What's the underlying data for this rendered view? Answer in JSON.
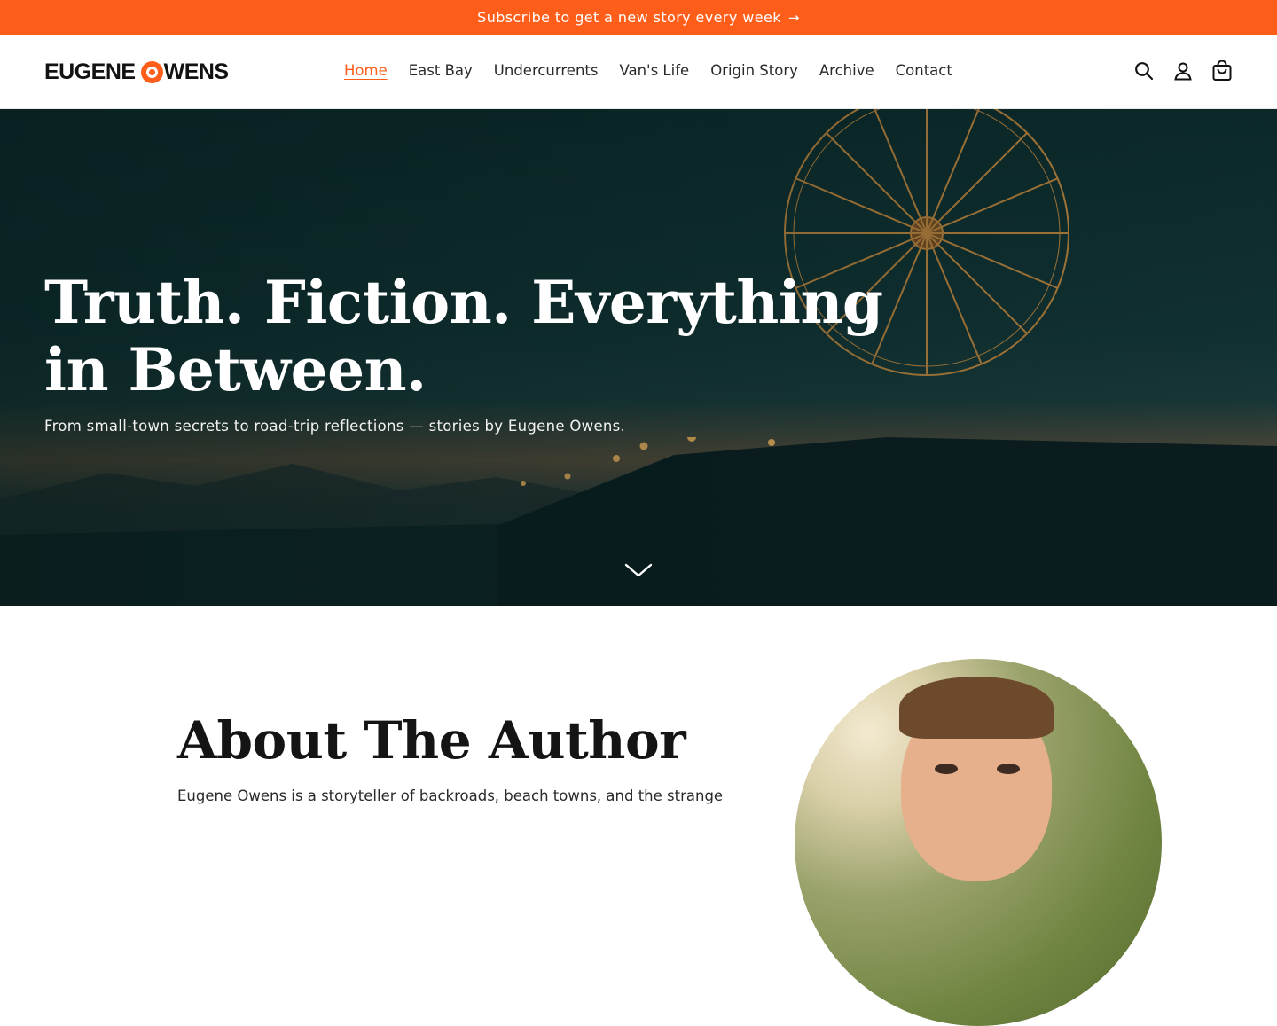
{
  "announcement": {
    "text": "Subscribe to get a new story every week",
    "arrow": "→",
    "background": "#ff5e1a"
  },
  "header": {
    "logo_left": "EUGENE",
    "logo_right": "WENS",
    "nav": [
      {
        "label": "Home",
        "active": true
      },
      {
        "label": "East Bay",
        "active": false
      },
      {
        "label": "Undercurrents",
        "active": false
      },
      {
        "label": "Van's Life",
        "active": false
      },
      {
        "label": "Origin Story",
        "active": false
      },
      {
        "label": "Archive",
        "active": false
      },
      {
        "label": "Contact",
        "active": false
      }
    ],
    "icons": [
      "search-icon",
      "account-icon",
      "cart-icon"
    ],
    "accent": "#ff5e1a"
  },
  "hero": {
    "title": "Truth. Fiction. Everything in Between.",
    "subtitle": "From small-town secrets to road-trip reflections — stories by Eugene Owens.",
    "scroll_icon": "chevron-down-icon"
  },
  "about": {
    "heading": "About The Author",
    "bio": "Eugene Owens is a storyteller of backroads, beach towns, and the strange"
  }
}
